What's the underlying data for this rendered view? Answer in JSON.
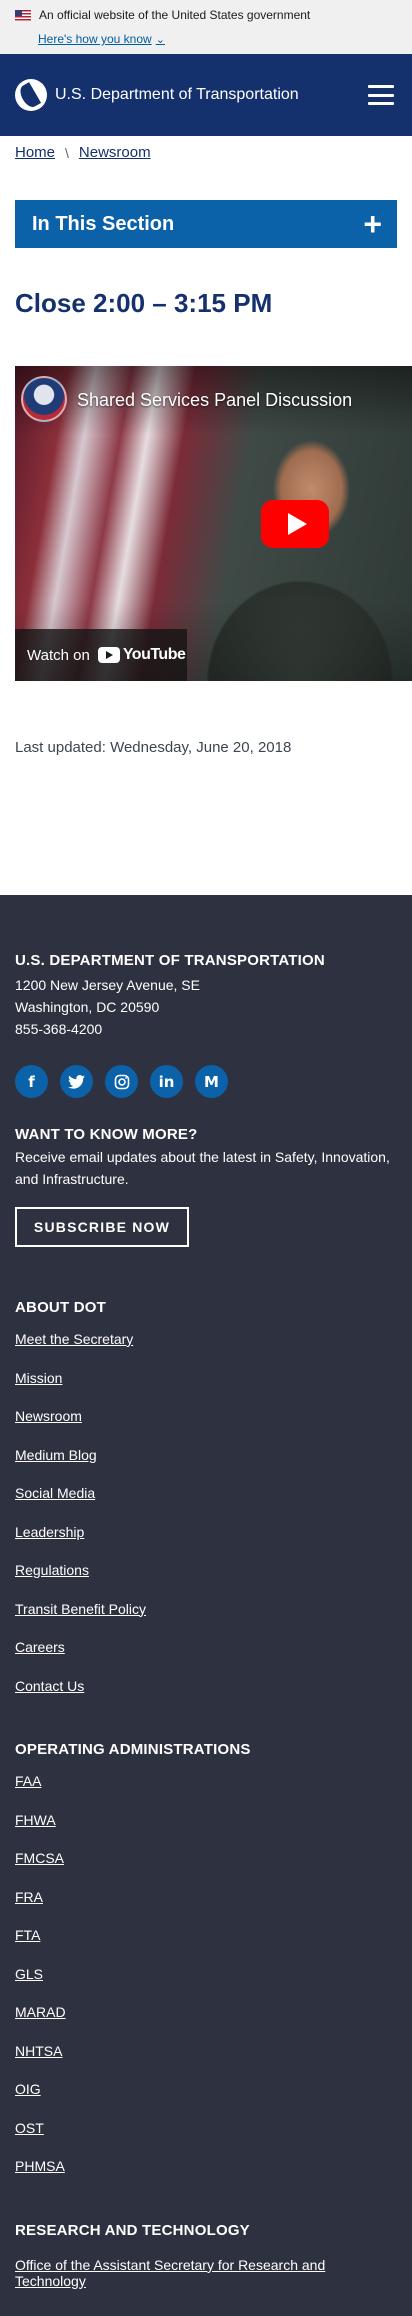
{
  "gov_banner": {
    "official_text": "An official website of the United States government",
    "how_you_know": "Here's how you know"
  },
  "header": {
    "site_title": "U.S. Department of Transportation"
  },
  "breadcrumb": {
    "items": [
      "Home",
      "Newsroom"
    ],
    "separator": "\\"
  },
  "section_nav": {
    "label": "In This Section",
    "toggle": "+"
  },
  "page": {
    "title": "Close 2:00 – 3:15 PM",
    "last_updated": "Last updated: Wednesday, June 20, 2018"
  },
  "video": {
    "title": "Shared Services Panel Discussion",
    "watch_on": "Watch on",
    "platform": "YouTube"
  },
  "footer": {
    "dept_name": "U.S. DEPARTMENT OF TRANSPORTATION",
    "address_line1": "1200 New Jersey Avenue, SE",
    "address_line2": "Washington, DC 20590",
    "phone": "855-368-4200",
    "social": [
      {
        "icon": "facebook-icon",
        "glyph": "f"
      },
      {
        "icon": "twitter-icon",
        "glyph": "🐦"
      },
      {
        "icon": "instagram-icon",
        "glyph": "◎"
      },
      {
        "icon": "linkedin-icon",
        "glyph": "in"
      },
      {
        "icon": "medium-icon",
        "glyph": "M"
      }
    ],
    "want_heading": "WANT TO KNOW MORE?",
    "want_text": "Receive email updates about the latest in Safety, Innovation, and Infrastructure.",
    "subscribe_label": "SUBSCRIBE NOW",
    "about_heading": "ABOUT DOT",
    "about_links": [
      "Meet the Secretary",
      "Mission",
      "Newsroom",
      "Medium Blog",
      "Social Media",
      "Leadership",
      "Regulations",
      "Transit Benefit Policy",
      "Careers",
      "Contact Us"
    ],
    "ops_heading": "OPERATING ADMINISTRATIONS",
    "ops_links": [
      "FAA",
      "FHWA",
      "FMCSA",
      "FRA",
      "FTA",
      "GLS",
      "MARAD",
      "NHTSA",
      "OIG",
      "OST",
      "PHMSA"
    ],
    "research_heading": "RESEARCH AND TECHNOLOGY",
    "research_links": [
      "Office of the Assistant Secretary for Research and Technology"
    ]
  },
  "colors": {
    "header_bg": "#14306d",
    "section_nav_bg": "#0b62a8",
    "footer_bg": "#2e3140",
    "link": "#005ea2"
  }
}
